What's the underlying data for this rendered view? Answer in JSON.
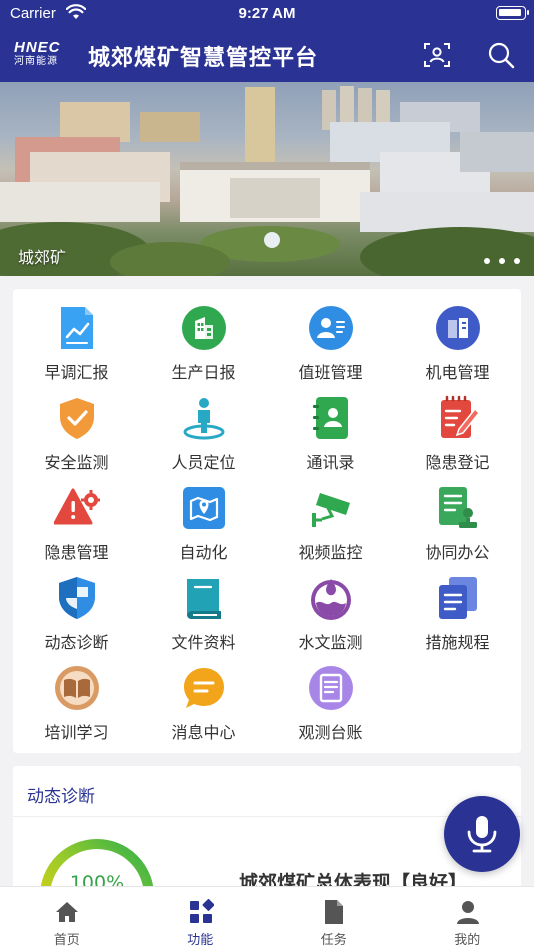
{
  "status": {
    "carrier": "Carrier",
    "time": "9:27 AM"
  },
  "header": {
    "logo_top": "HNEC",
    "logo_bottom": "河南能源",
    "title": "城郊煤矿智慧管控平台"
  },
  "banner": {
    "caption": "城郊矿",
    "page_count": 3
  },
  "grid": {
    "items": [
      {
        "label": "早调汇报",
        "icon": "report-chart-icon",
        "color": "#3aa2f2"
      },
      {
        "label": "生产日报",
        "icon": "building-icon",
        "color": "#2fa84f"
      },
      {
        "label": "值班管理",
        "icon": "duty-person-icon",
        "color": "#2f8de4"
      },
      {
        "label": "机电管理",
        "icon": "equipment-icon",
        "color": "#3f5bc7"
      },
      {
        "label": "安全监测",
        "icon": "safety-shield-icon",
        "color": "#f29a3a"
      },
      {
        "label": "人员定位",
        "icon": "person-location-icon",
        "color": "#27a9c6"
      },
      {
        "label": "通讯录",
        "icon": "contacts-book-icon",
        "color": "#2fa84f"
      },
      {
        "label": "隐患登记",
        "icon": "hazard-register-icon",
        "color": "#e2483d"
      },
      {
        "label": "隐患管理",
        "icon": "warning-gear-icon",
        "color": "#e2483d"
      },
      {
        "label": "自动化",
        "icon": "map-location-icon",
        "color": "#2f8de4"
      },
      {
        "label": "视频监控",
        "icon": "cctv-camera-icon",
        "color": "#2fa84f"
      },
      {
        "label": "协同办公",
        "icon": "document-stamp-icon",
        "color": "#3aa85a"
      },
      {
        "label": "动态诊断",
        "icon": "shield-check-icon",
        "color": "#2f8de4"
      },
      {
        "label": "文件资料",
        "icon": "book-file-icon",
        "color": "#22a2b5"
      },
      {
        "label": "水文监测",
        "icon": "water-drop-icon",
        "color": "#8a4aa8"
      },
      {
        "label": "措施规程",
        "icon": "documents-icon",
        "color": "#3f5bc7"
      },
      {
        "label": "培训学习",
        "icon": "open-book-icon",
        "color": "#d99a64"
      },
      {
        "label": "消息中心",
        "icon": "message-bubble-icon",
        "color": "#f2a51a"
      },
      {
        "label": "观测台账",
        "icon": "ledger-icon",
        "color": "#a886e8"
      }
    ]
  },
  "diagnosis": {
    "title": "动态诊断",
    "percent": "100%",
    "percent_value": 1.0,
    "summary": "城郊煤矿总体表现【良好】"
  },
  "tabs": [
    {
      "label": "首页",
      "icon": "home-icon"
    },
    {
      "label": "功能",
      "icon": "grid-icon"
    },
    {
      "label": "任务",
      "icon": "task-file-icon"
    },
    {
      "label": "我的",
      "icon": "user-icon"
    }
  ],
  "active_tab": 1,
  "theme": {
    "primary": "#2a3394"
  }
}
